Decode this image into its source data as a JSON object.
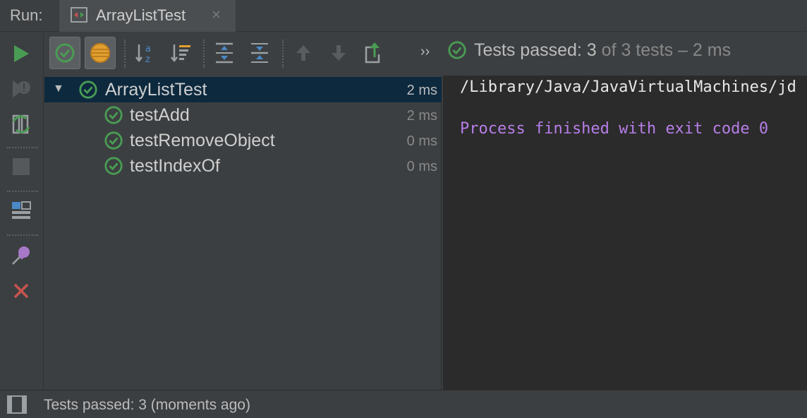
{
  "window": {
    "run_label": "Run:",
    "tab_title": "ArrayListTest",
    "tab_close": "×"
  },
  "left_toolbar": {
    "items": [
      {
        "icon": "run-icon",
        "label": "Rerun"
      },
      {
        "icon": "rerun-failed-icon",
        "label": "Rerun failed tests"
      },
      {
        "icon": "toggle-auto-test-icon",
        "label": "Toggle auto-test"
      },
      {
        "icon": "stop-icon",
        "label": "Stop"
      },
      {
        "icon": "layout-icon",
        "label": "Restore layout"
      },
      {
        "icon": "pin-icon",
        "label": "Pin tab"
      },
      {
        "icon": "close-icon",
        "label": "Close"
      }
    ]
  },
  "top_toolbar": {
    "more": "››",
    "status": {
      "part1": "Tests passed: 3",
      "part2": " of 3 tests – 2 ms"
    }
  },
  "tree": {
    "root": {
      "name": "ArrayListTest",
      "time": "2 ms",
      "expanded": true
    },
    "children": [
      {
        "name": "testAdd",
        "time": "2 ms"
      },
      {
        "name": "testRemoveObject",
        "time": "0 ms"
      },
      {
        "name": "testIndexOf",
        "time": "0 ms"
      }
    ]
  },
  "console": {
    "path_line": "/Library/Java/JavaVirtualMachines/jd",
    "exit_line": "Process finished with exit code 0"
  },
  "status_bar": {
    "text": "Tests passed: 3 (moments ago)"
  },
  "colors": {
    "pass_green": "#499c54",
    "accent_stop": "#c75450",
    "console_purple": "#b77ee8",
    "selection": "#0d293e"
  }
}
